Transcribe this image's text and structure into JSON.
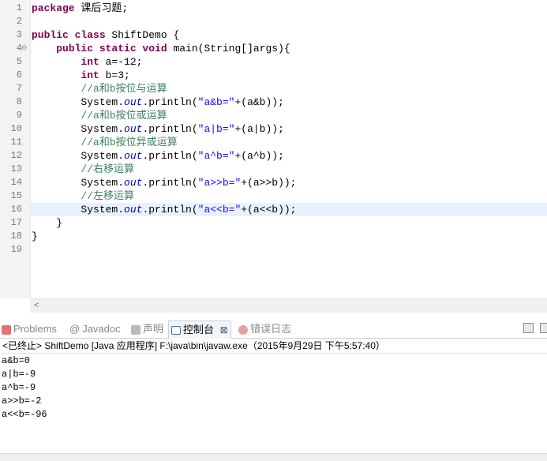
{
  "editor": {
    "lines": [
      {
        "n": "1",
        "fold": "",
        "segs": [
          {
            "t": "package",
            "c": "kw"
          },
          {
            "t": " 课后习题;",
            "c": ""
          }
        ]
      },
      {
        "n": "2",
        "fold": "",
        "segs": []
      },
      {
        "n": "3",
        "fold": "",
        "segs": [
          {
            "t": "public class",
            "c": "kw"
          },
          {
            "t": " ShiftDemo {",
            "c": ""
          }
        ]
      },
      {
        "n": "4",
        "fold": "⊖",
        "segs": [
          {
            "t": "    ",
            "c": ""
          },
          {
            "t": "public static void",
            "c": "kw"
          },
          {
            "t": " main(String[]args){",
            "c": ""
          }
        ]
      },
      {
        "n": "5",
        "fold": "",
        "segs": [
          {
            "t": "        ",
            "c": ""
          },
          {
            "t": "int",
            "c": "kw"
          },
          {
            "t": " a=-12;",
            "c": ""
          }
        ]
      },
      {
        "n": "6",
        "fold": "",
        "segs": [
          {
            "t": "        ",
            "c": ""
          },
          {
            "t": "int",
            "c": "kw"
          },
          {
            "t": " b=3;",
            "c": ""
          }
        ]
      },
      {
        "n": "7",
        "fold": "",
        "segs": [
          {
            "t": "        //a和b按位与运算",
            "c": "cmt"
          }
        ]
      },
      {
        "n": "8",
        "fold": "",
        "segs": [
          {
            "t": "        System.",
            "c": ""
          },
          {
            "t": "out",
            "c": "fld"
          },
          {
            "t": ".println(",
            "c": ""
          },
          {
            "t": "\"a&b=\"",
            "c": "str"
          },
          {
            "t": "+(a&b));",
            "c": ""
          }
        ]
      },
      {
        "n": "9",
        "fold": "",
        "segs": [
          {
            "t": "        //a和b按位或运算",
            "c": "cmt"
          }
        ]
      },
      {
        "n": "10",
        "fold": "",
        "segs": [
          {
            "t": "        System.",
            "c": ""
          },
          {
            "t": "out",
            "c": "fld"
          },
          {
            "t": ".println(",
            "c": ""
          },
          {
            "t": "\"a|b=\"",
            "c": "str"
          },
          {
            "t": "+(a|b));",
            "c": ""
          }
        ]
      },
      {
        "n": "11",
        "fold": "",
        "segs": [
          {
            "t": "        //a和b按位异或运算",
            "c": "cmt"
          }
        ]
      },
      {
        "n": "12",
        "fold": "",
        "segs": [
          {
            "t": "        System.",
            "c": ""
          },
          {
            "t": "out",
            "c": "fld"
          },
          {
            "t": ".println(",
            "c": ""
          },
          {
            "t": "\"a^b=\"",
            "c": "str"
          },
          {
            "t": "+(a^b));",
            "c": ""
          }
        ]
      },
      {
        "n": "13",
        "fold": "",
        "segs": [
          {
            "t": "        //右移运算",
            "c": "cmt"
          }
        ]
      },
      {
        "n": "14",
        "fold": "",
        "segs": [
          {
            "t": "        System.",
            "c": ""
          },
          {
            "t": "out",
            "c": "fld"
          },
          {
            "t": ".println(",
            "c": ""
          },
          {
            "t": "\"a>>b=\"",
            "c": "str"
          },
          {
            "t": "+(a>>b));",
            "c": ""
          }
        ]
      },
      {
        "n": "15",
        "fold": "",
        "segs": [
          {
            "t": "        //左移运算",
            "c": "cmt"
          }
        ]
      },
      {
        "n": "16",
        "fold": "",
        "hl": true,
        "segs": [
          {
            "t": "        System.",
            "c": ""
          },
          {
            "t": "out",
            "c": "fld"
          },
          {
            "t": ".println(",
            "c": ""
          },
          {
            "t": "\"a<<b=\"",
            "c": "str"
          },
          {
            "t": "+(a<<b));",
            "c": ""
          }
        ]
      },
      {
        "n": "17",
        "fold": "",
        "segs": [
          {
            "t": "    }",
            "c": ""
          }
        ]
      },
      {
        "n": "18",
        "fold": "",
        "segs": [
          {
            "t": "}",
            "c": ""
          }
        ]
      },
      {
        "n": "19",
        "fold": "",
        "segs": []
      }
    ]
  },
  "tabs": {
    "problems": "Problems",
    "javadoc": "Javadoc",
    "declaration": "声明",
    "console": "控制台",
    "console_close": "⊠",
    "errorlog": "错误日志"
  },
  "console": {
    "status": "<已终止> ShiftDemo [Java 应用程序] F:\\java\\bin\\javaw.exe（2015年9月29日 下午5:57:40）",
    "output": [
      "a&b=0",
      "a|b=-9",
      "a^b=-9",
      "a>>b=-2",
      "a<<b=-96"
    ]
  },
  "colors": {
    "keyword": "#7f0055",
    "string": "#2a00ff",
    "comment": "#3f7f5f",
    "field": "#0000c0",
    "current_line": "#e8f2fe"
  }
}
